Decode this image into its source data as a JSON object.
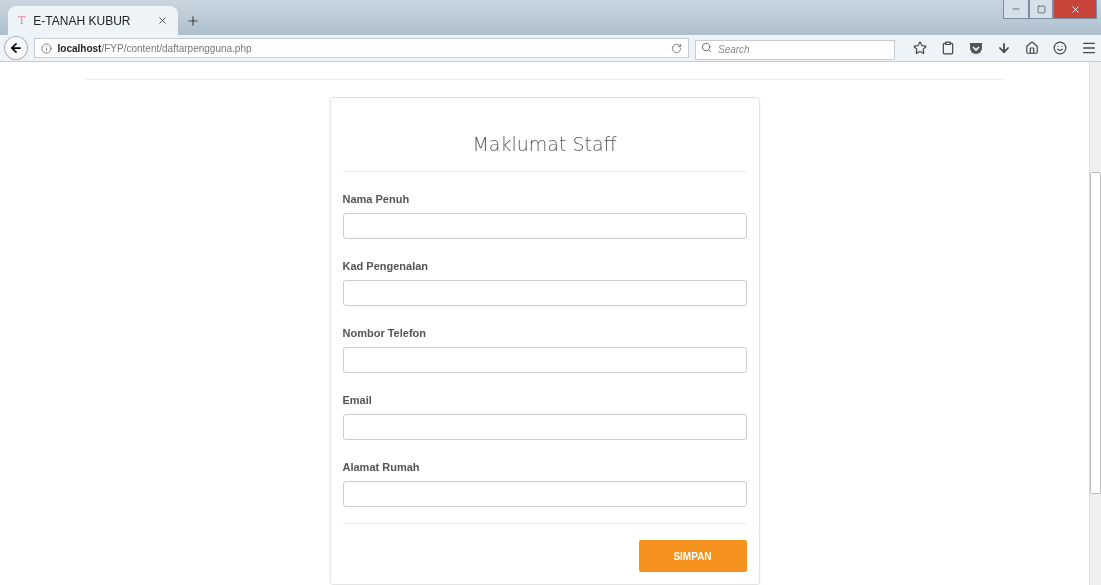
{
  "browser": {
    "tab": {
      "favicon": "T",
      "title": "E-TANAH KUBUR",
      "selected": true
    },
    "url": "**localhost**/FYP/content/daftarpengguna.php",
    "search": {
      "placeholder": "Search"
    }
  },
  "form": {
    "title": "Maklumat Staff",
    "fields": [
      {
        "label": "Nama Penuh"
      },
      {
        "label": "Kad Pengenalan"
      },
      {
        "label": "Nombor Telefon"
      },
      {
        "label": "Email"
      },
      {
        "label": "Alamat Rumah"
      }
    ],
    "submit": "SIMPAN"
  }
}
